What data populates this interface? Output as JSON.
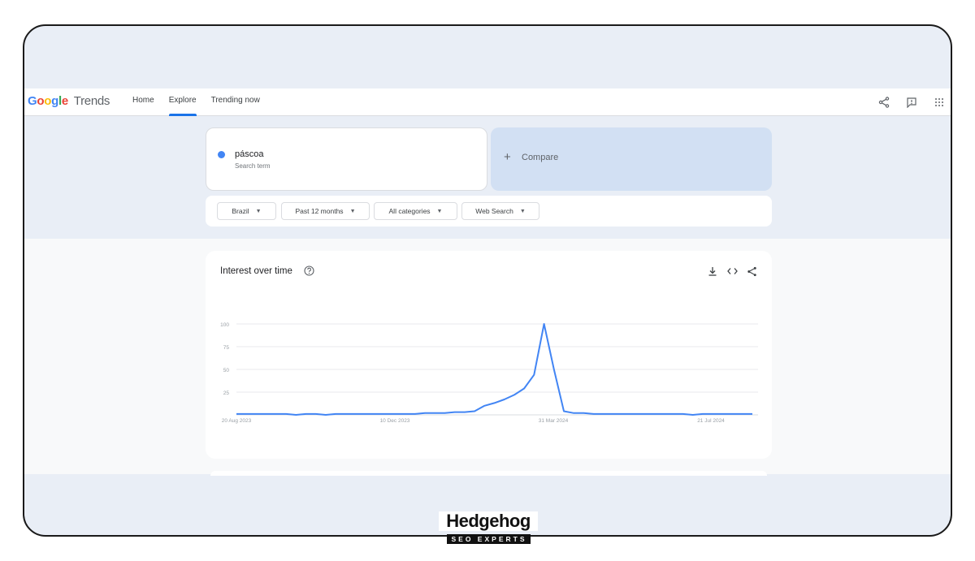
{
  "header": {
    "logo_google": "Google",
    "logo_trends": "Trends",
    "nav": [
      "Home",
      "Explore",
      "Trending now"
    ],
    "active_nav": "Explore",
    "icons": [
      "share-icon",
      "feedback-icon",
      "apps-grid-icon"
    ]
  },
  "search": {
    "term": "páscoa",
    "term_type": "Search term",
    "term_color": "#4285f4",
    "compare_label": "Compare"
  },
  "filters": {
    "region": "Brazil",
    "period": "Past 12 months",
    "category": "All categories",
    "search_type": "Web Search"
  },
  "chart_card": {
    "title": "Interest over time",
    "icons": [
      "help-icon",
      "download-icon",
      "embed-icon",
      "share-icon"
    ]
  },
  "chart_data": {
    "type": "line",
    "title": "Interest over time",
    "x_tick_labels": [
      "20 Aug 2023",
      "10 Dec 2023",
      "31 Mar 2024",
      "21 Jul 2024"
    ],
    "y_tick_labels": [
      "25",
      "50",
      "75",
      "100"
    ],
    "ylim": [
      0,
      100
    ],
    "grid": true,
    "series": [
      {
        "color": "#4285f4",
        "values": [
          1,
          1,
          1,
          1,
          1,
          1,
          0,
          1,
          1,
          0,
          1,
          1,
          1,
          1,
          1,
          1,
          1,
          1,
          1,
          2,
          2,
          2,
          3,
          3,
          4,
          10,
          13,
          17,
          22,
          29,
          44,
          100,
          50,
          4,
          2,
          2,
          1,
          1,
          1,
          1,
          1,
          1,
          1,
          1,
          1,
          1,
          0,
          1,
          1,
          1,
          1,
          1,
          1
        ]
      }
    ]
  },
  "branding": {
    "name": "Hedgehog",
    "tagline": "SEO EXPERTS"
  }
}
